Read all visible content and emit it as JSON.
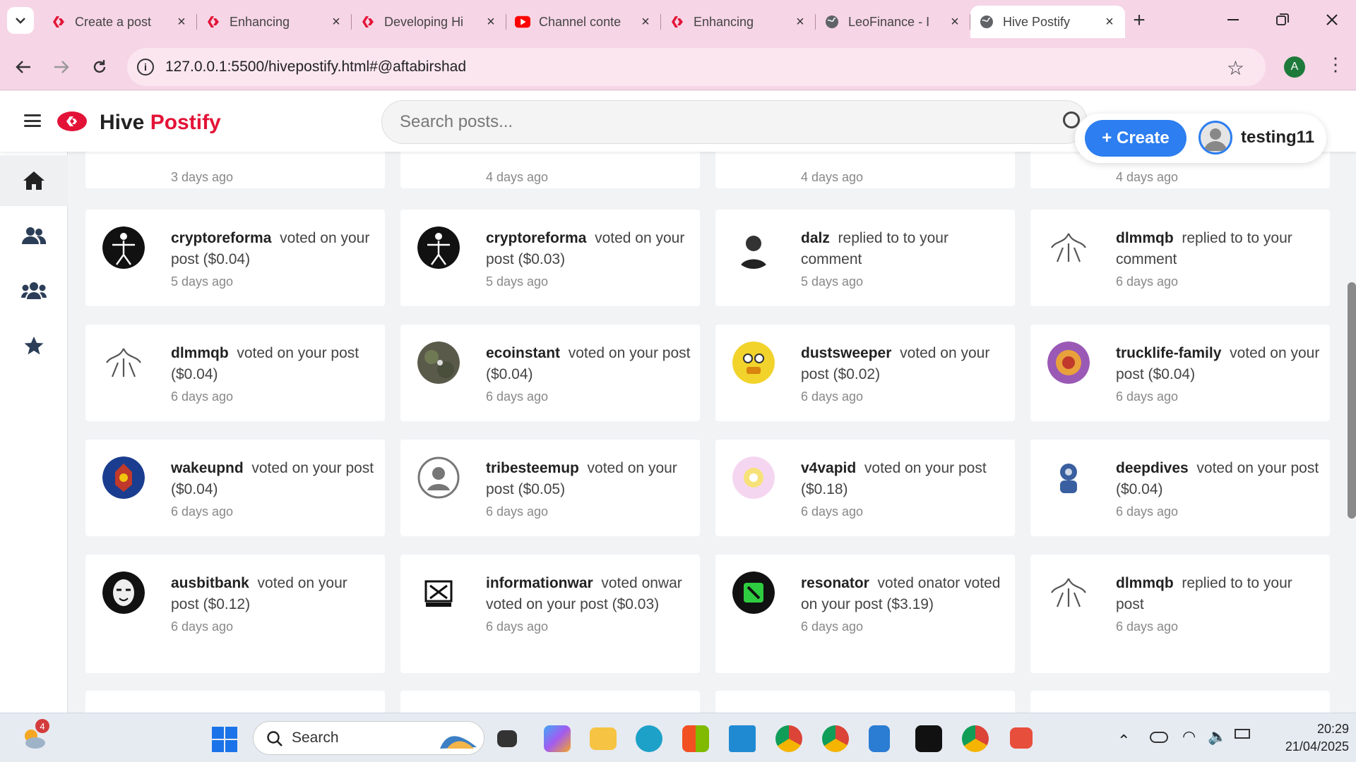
{
  "browser": {
    "tabs": [
      {
        "title": "Create a post",
        "favicon": "hive-icon"
      },
      {
        "title": "Enhancing",
        "favicon": "hive-icon"
      },
      {
        "title": "Developing Hi",
        "favicon": "hive-icon"
      },
      {
        "title": "Channel conte",
        "favicon": "youtube-icon"
      },
      {
        "title": "Enhancing",
        "favicon": "hive-icon"
      },
      {
        "title": "LeoFinance - I",
        "favicon": "globe-icon"
      },
      {
        "title": "Hive Postify",
        "favicon": "globe-icon",
        "active": true
      }
    ],
    "new_tab": "+",
    "url": "127.0.0.1:5500/hivepostify.html#@aftabirshad",
    "profile_initial": "A"
  },
  "app": {
    "brand_first": "Hive ",
    "brand_second": "Postify",
    "search_placeholder": "Search posts...",
    "create_label": "+ Create",
    "username": "testing11",
    "accent": "#e31337",
    "button_color": "#2d7ef0"
  },
  "sidebar": [
    "home-icon",
    "users-icon",
    "communities-icon",
    "star-icon"
  ],
  "notifications_top": [
    {
      "time": "3 days ago"
    },
    {
      "time": "4 days ago"
    },
    {
      "time": "4 days ago"
    },
    {
      "time": "4 days ago"
    }
  ],
  "notifications": [
    {
      "user": "cryptoreforma",
      "action": "voted  on your post ($0.04)",
      "time": "5 days ago"
    },
    {
      "user": "cryptoreforma",
      "action": "voted  on your post ($0.03)",
      "time": "5 days ago"
    },
    {
      "user": "dalz",
      "action": "replied to  to your comment",
      "time": "5 days ago"
    },
    {
      "user": "dlmmqb",
      "action": "replied to  to your comment",
      "time": "6 days ago"
    },
    {
      "user": "dlmmqb",
      "action": "voted  on your post ($0.04)",
      "time": "6 days ago"
    },
    {
      "user": "ecoinstant",
      "action": "voted  on your post ($0.04)",
      "time": "6 days ago"
    },
    {
      "user": "dustsweeper",
      "action": "voted  on your post ($0.02)",
      "time": "6 days ago"
    },
    {
      "user": "trucklife-family",
      "action": "voted  on your post ($0.04)",
      "time": "6 days ago"
    },
    {
      "user": "wakeupnd",
      "action": "voted  on your post ($0.04)",
      "time": "6 days ago"
    },
    {
      "user": "tribesteemup",
      "action": "voted  on your post ($0.05)",
      "time": "6 days ago"
    },
    {
      "user": "v4vapid",
      "action": "voted  on your post ($0.18)",
      "time": "6 days ago"
    },
    {
      "user": "deepdives",
      "action": "voted  on your post ($0.04)",
      "time": "6 days ago"
    },
    {
      "user": "ausbitbank",
      "action": "voted  on your post ($0.12)",
      "time": "6 days ago"
    },
    {
      "user": "informationwar",
      "action": "voted  onwar voted on your post ($0.03)",
      "time": "6 days ago"
    },
    {
      "user": "resonator",
      "action": "voted  onator voted on your post ($3.19)",
      "time": "6 days ago"
    },
    {
      "user": "dlmmqb",
      "action": "replied to  to your post",
      "time": "6 days ago"
    }
  ],
  "taskbar": {
    "search_label": "Search",
    "notif_count": "4",
    "time": "20:29",
    "date": "21/04/2025"
  }
}
